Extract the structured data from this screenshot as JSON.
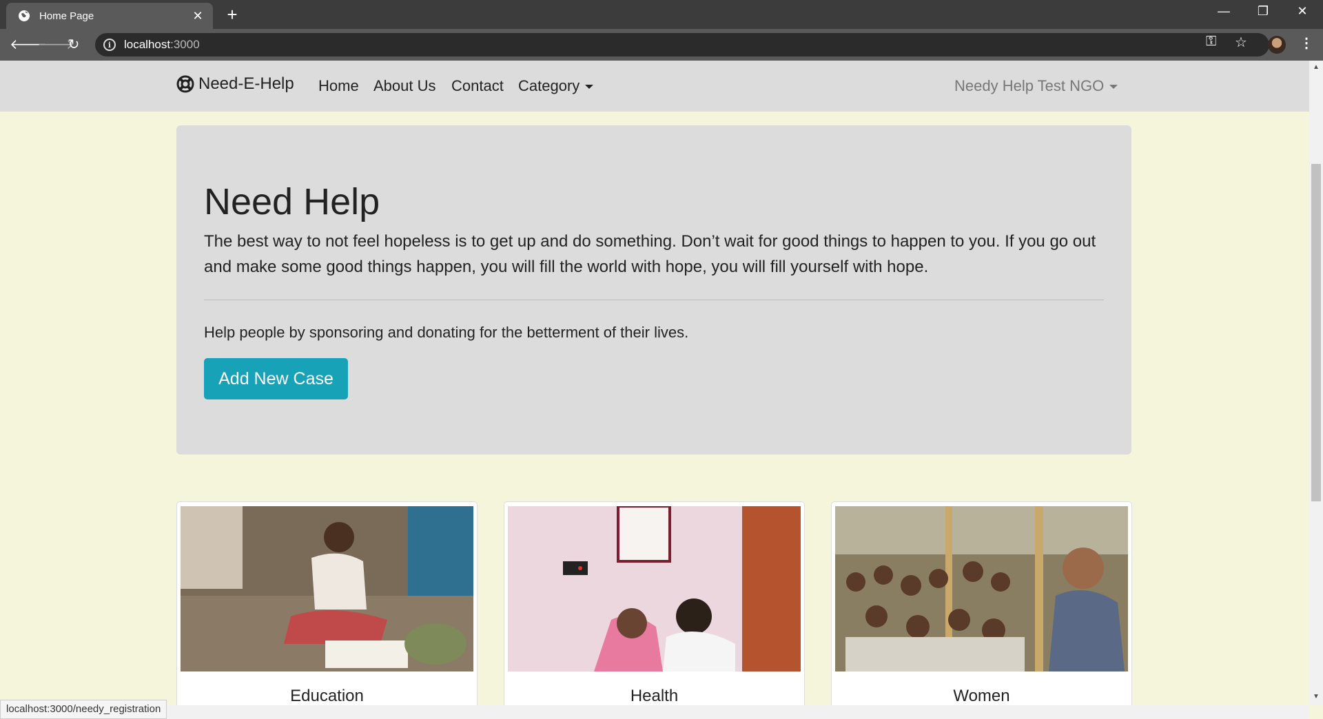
{
  "browser": {
    "tab_title": "Home Page",
    "tab_close": "✕",
    "new_tab": "+",
    "url_host": "localhost",
    "url_port": ":3000",
    "status_url": "localhost:3000/needy_registration",
    "window_controls": {
      "minimize": "—",
      "restore": "❐",
      "close": "✕"
    },
    "icons": [
      "globe-icon",
      "back-icon",
      "forward-icon",
      "reload-icon",
      "info-icon",
      "key-icon",
      "star-icon",
      "menu-icon"
    ]
  },
  "navbar": {
    "brand": "Need-E-Help",
    "links": [
      "Home",
      "About Us",
      "Contact",
      "Category"
    ],
    "user": "Needy Help Test NGO"
  },
  "hero": {
    "title": "Need Help",
    "lead": "The best way to not feel hopeless is to get up and do something. Don’t wait for good things to happen to you. If you go out and make some good things happen, you will fill the world with hope, you will fill yourself with hope.",
    "text": "Help people by sponsoring and donating for the betterment of their lives.",
    "button": "Add New Case",
    "button_color": "#17a2b8"
  },
  "cards": [
    {
      "title": "Education"
    },
    {
      "title": "Health"
    },
    {
      "title": "Women"
    }
  ],
  "colors": {
    "page_bg": "#f5f5dc",
    "navbar_bg": "#dcdcdc",
    "jumbotron_bg": "#dcdcdc"
  }
}
